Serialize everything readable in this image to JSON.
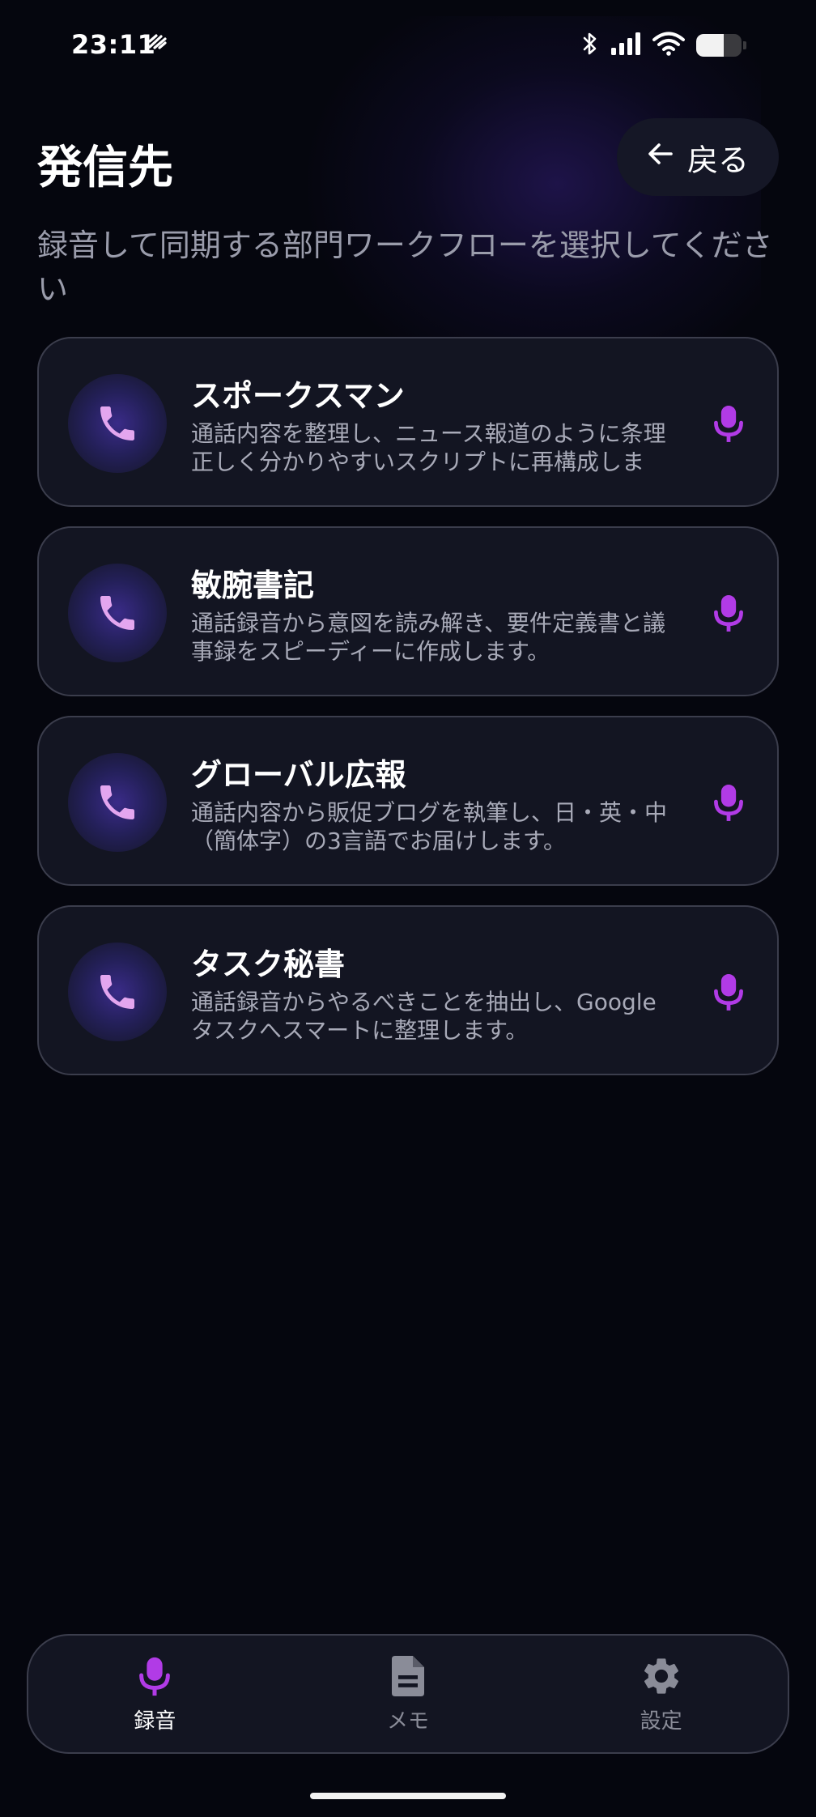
{
  "status_bar": {
    "time": "23:11",
    "battery_level": 0.6
  },
  "header": {
    "title": "発信先",
    "back_label": "戻る",
    "subtitle": "録音して同期する部門ワークフローを選択してください"
  },
  "workflows": [
    {
      "title": "スポークスマン",
      "description": "通話内容を整理し、ニュース報道のように条理正しく分かりやすいスクリプトに再構成しま"
    },
    {
      "title": "敏腕書記",
      "description": "通話録音から意図を読み解き、要件定義書と議事録をスピーディーに作成します。"
    },
    {
      "title": "グローバル広報",
      "description": "通話内容から販促ブログを執筆し、日・英・中（簡体字）の3言語でお届けします。"
    },
    {
      "title": "タスク秘書",
      "description": "通話録音からやるべきことを抽出し、Google タスクへスマートに整理します。"
    }
  ],
  "bottom_nav": {
    "items": [
      {
        "label": "録音",
        "icon": "mic-icon",
        "active": true
      },
      {
        "label": "メモ",
        "icon": "document-icon",
        "active": false
      },
      {
        "label": "設定",
        "icon": "gear-icon",
        "active": false
      }
    ]
  },
  "colors": {
    "background": "#05060e",
    "card_background": "#131522",
    "card_border": "#3b3d4c",
    "accent_purple": "#b13be6",
    "phone_icon": "#e3a6ef"
  }
}
